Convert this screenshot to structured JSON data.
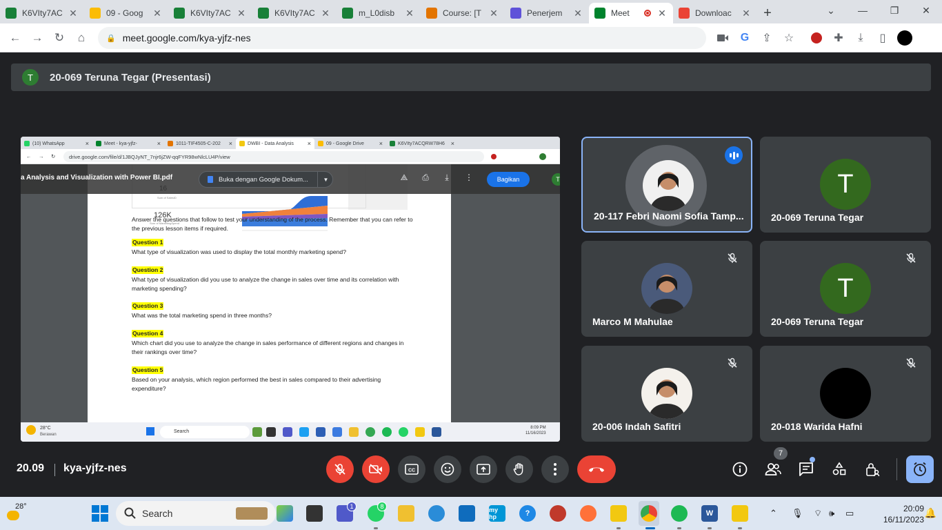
{
  "browser": {
    "tabs": [
      {
        "title": "K6VIty7AC",
        "icon_color": "#188038",
        "active": false
      },
      {
        "title": "09 - Goog",
        "icon_color": "#fbbc04",
        "active": false
      },
      {
        "title": "K6VIty7AC",
        "icon_color": "#188038",
        "active": false
      },
      {
        "title": "K6VIty7AC",
        "icon_color": "#188038",
        "active": false
      },
      {
        "title": "m_L0disb",
        "icon_color": "#188038",
        "active": false
      },
      {
        "title": "Course: [T",
        "icon_color": "#e37400",
        "active": false
      },
      {
        "title": "Penerjem",
        "icon_color": "#5f52d9",
        "active": false
      },
      {
        "title": "Meet",
        "icon_color": "#00832d",
        "active": true
      },
      {
        "title": "Downloac",
        "icon_color": "#ea4335",
        "active": false
      }
    ],
    "url": "meet.google.com/kya-yjfz-nes",
    "toolbar_icons": [
      "camera-icon",
      "google-icon",
      "share-icon",
      "bookmark-star-icon",
      "extension-red-icon",
      "puzzle-icon",
      "download-icon",
      "sidepanel-icon",
      "profile-avatar"
    ]
  },
  "banner": {
    "avatar_letter": "T",
    "title": "20-069 Teruna Tegar (Presentasi)"
  },
  "presentation": {
    "inner_tabs": [
      "(10) WhatsApp",
      "Meet - kya-yjfz-",
      "1011-TIF4505-C-202",
      "DWBI - Data Analysis",
      "09 - Google Drive",
      "K6VIty7ACQRW78H6"
    ],
    "inner_url": "drive.google.com/file/d/1JBQJyNT_7njr6jZW-qqFYR98wNlcLU4P/view",
    "file_name": "a Analysis and Visualization with Power BI.pdf",
    "open_with": "Buka dengan Google Dokum...",
    "share_label": "Bagikan",
    "user_initial": "T",
    "kpi_top": "16",
    "kpi_main": "126K",
    "kpi_label_1": "Sum of SalesID",
    "kpi_label_2": "Sum of MarketingSpend",
    "intro": "Answer the questions that follow to test your understanding of the process. Remember that you can refer to the previous lesson items if required.",
    "questions": [
      {
        "label": "Question 1",
        "text": "What type of visualization was used to display the total monthly marketing spend?"
      },
      {
        "label": "Question 2",
        "text": "What type of visualization did you use to analyze the change in sales over time and its correlation with marketing spending?"
      },
      {
        "label": "Question 3",
        "text": "What was the total marketing spend in three months?"
      },
      {
        "label": "Question 4",
        "text": "Which chart did you use to analyze the change in sales performance of different regions and changes in their rankings over time?"
      },
      {
        "label": "Question 5",
        "text": "Based on your analysis, which region performed the best in sales compared to their advertising expenditure?"
      }
    ],
    "taskbar": {
      "weather_temp": "28°C",
      "weather_desc": "Berawan",
      "search": "Search",
      "time": "8:09 PM",
      "date": "11/16/2023"
    }
  },
  "participants": [
    {
      "name": "20-117 Febri Naomi Sofia Tamp...",
      "speaking": true,
      "muted": false,
      "avatar": "photo",
      "avatar_color": "#f0f0f0"
    },
    {
      "name": "20-069 Teruna Tegar",
      "speaking": false,
      "muted": false,
      "avatar_letter": "T",
      "avatar_color": "#33691e"
    },
    {
      "name": "Marco M Mahulae",
      "speaking": false,
      "muted": true,
      "avatar": "photo",
      "avatar_color": "#4a5a7a"
    },
    {
      "name": "20-069 Teruna Tegar",
      "speaking": false,
      "muted": true,
      "avatar_letter": "T",
      "avatar_color": "#33691e"
    },
    {
      "name": "20-006 Indah Safitri",
      "speaking": false,
      "muted": true,
      "avatar": "photo",
      "avatar_color": "#f4f1ec"
    },
    {
      "name": "20-018 Warida Hafni",
      "speaking": false,
      "muted": true,
      "avatar": "photo",
      "avatar_color": "#000000"
    }
  ],
  "meetbar": {
    "time": "20.09",
    "meeting_code": "kya-yjfz-nes",
    "people_count": "7"
  },
  "windows_taskbar": {
    "weather_temp": "28°",
    "search": "Search",
    "whatsapp_badge": "8",
    "teams_badge": "1",
    "time": "20:09",
    "date": "16/11/2023"
  }
}
